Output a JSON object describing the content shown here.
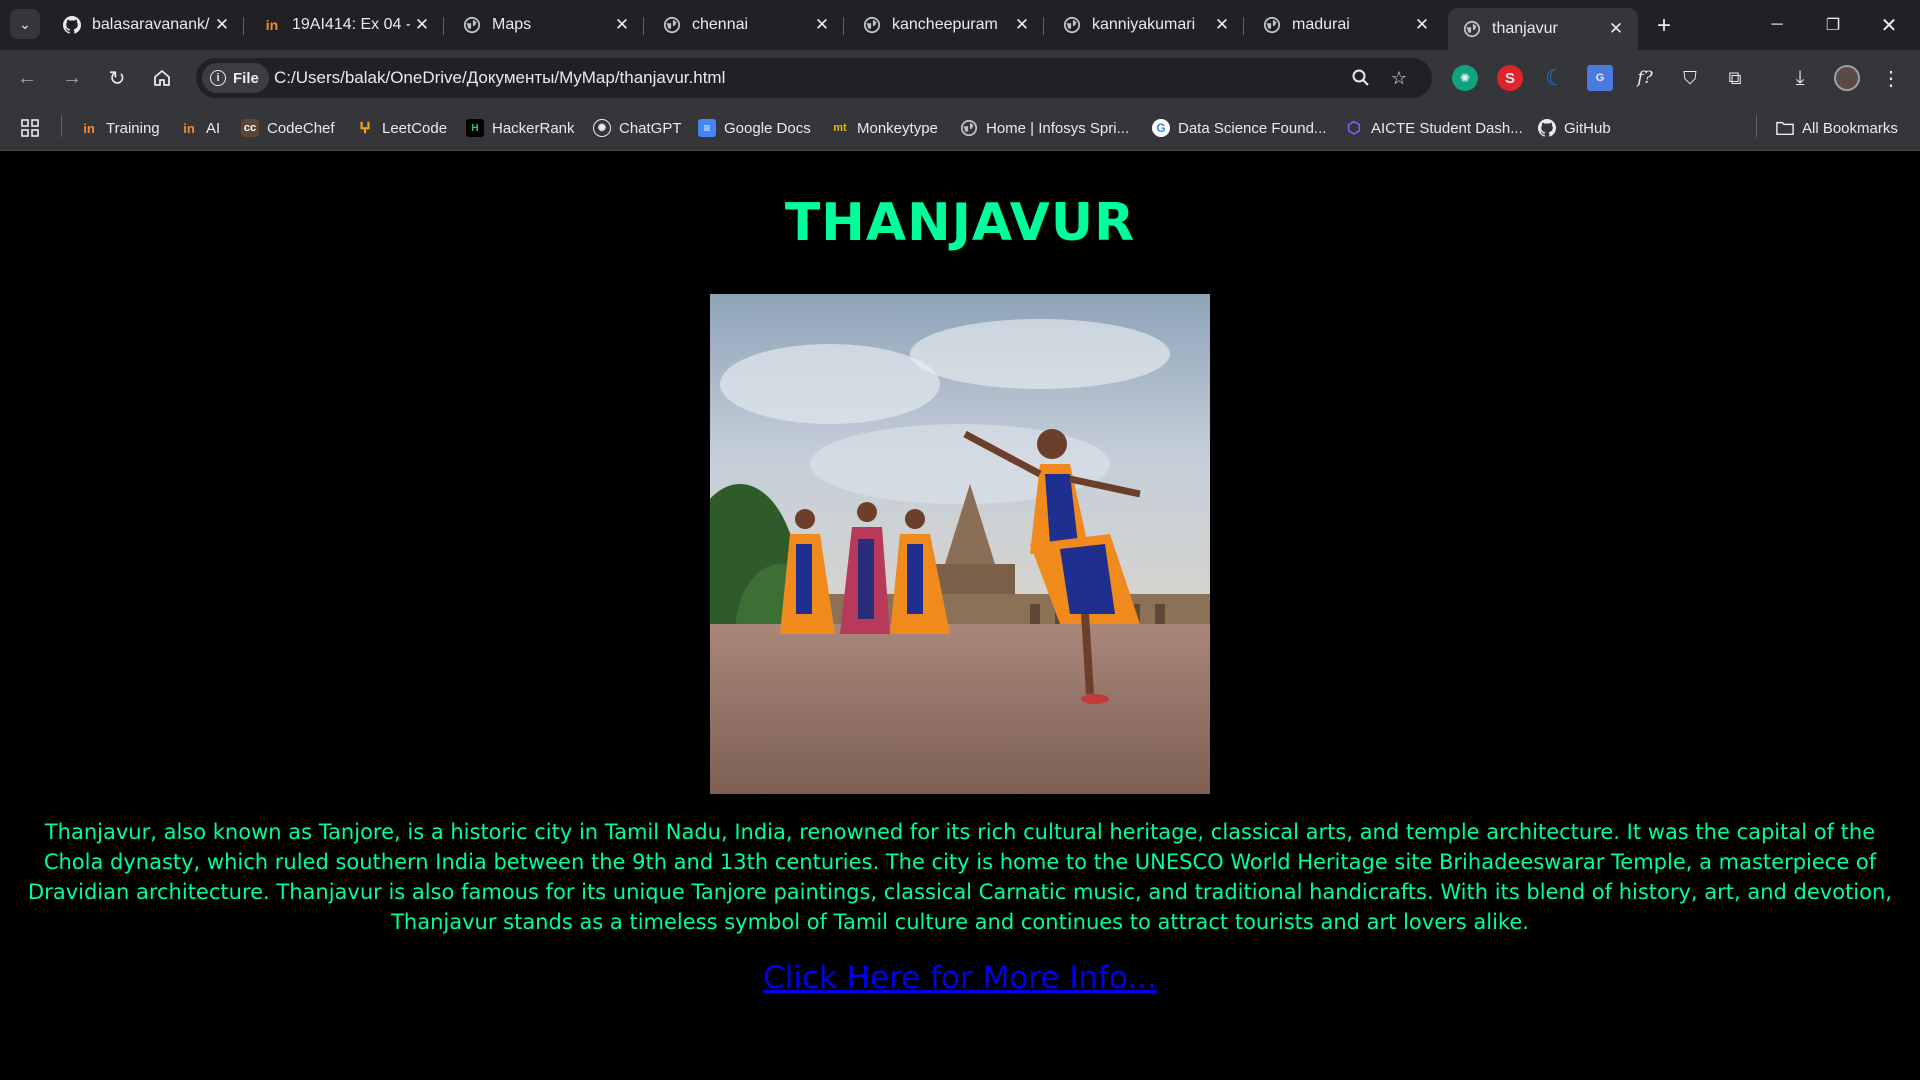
{
  "tabs": [
    {
      "title": "balasaravanank/",
      "icon": "github-icon"
    },
    {
      "title": "19AI414: Ex 04 -",
      "icon": "infosys-icon"
    },
    {
      "title": "Maps",
      "icon": "globe-icon"
    },
    {
      "title": "chennai",
      "icon": "globe-icon"
    },
    {
      "title": "kancheepuram",
      "icon": "globe-icon"
    },
    {
      "title": "kanniyakumari",
      "icon": "globe-icon"
    },
    {
      "title": "madurai",
      "icon": "globe-icon"
    },
    {
      "title": "thanjavur",
      "icon": "globe-icon",
      "active": true
    }
  ],
  "toolbar": {
    "chip_label": "File",
    "url": "C:/Users/balak/OneDrive/Документы/MyMap/thanjavur.html"
  },
  "bookmarks": [
    {
      "label": "Training",
      "icon": "infosys-icon"
    },
    {
      "label": "AI",
      "icon": "infosys-icon"
    },
    {
      "label": "CodeChef",
      "icon": "codechef-icon"
    },
    {
      "label": "LeetCode",
      "icon": "leetcode-icon"
    },
    {
      "label": "HackerRank",
      "icon": "hackerrank-icon"
    },
    {
      "label": "ChatGPT",
      "icon": "chatgpt-icon"
    },
    {
      "label": "Google Docs",
      "icon": "google-docs-icon"
    },
    {
      "label": "Monkeytype",
      "icon": "monkeytype-icon"
    },
    {
      "label": "Home | Infosys Spri...",
      "icon": "globe-icon"
    },
    {
      "label": "Data Science Found...",
      "icon": "google-icon"
    },
    {
      "label": "AICTE Student Dash...",
      "icon": "aicte-icon"
    },
    {
      "label": "GitHub",
      "icon": "github-icon"
    }
  ],
  "all_bookmarks_label": "All Bookmarks",
  "page": {
    "heading": "THANJAVUR",
    "description": "Thanjavur, also known as Tanjore, is a historic city in Tamil Nadu, India, renowned for its rich cultural heritage, classical arts, and temple architecture. It was the capital of the Chola dynasty, which ruled southern India between the 9th and 13th centuries. The city is home to the UNESCO World Heritage site Brihadeeswarar Temple, a masterpiece of Dravidian architecture. Thanjavur is also famous for its unique Tanjore paintings, classical Carnatic music, and traditional handicrafts. With its blend of history, art, and devotion, Thanjavur stands as a timeless symbol of Tamil culture and continues to attract tourists and art lovers alike.",
    "link_text": "Click Here for More Info...",
    "colors": {
      "heading": "#00ff9a",
      "text": "#00ff9a",
      "link": "#0000ee",
      "background": "#000000"
    }
  }
}
